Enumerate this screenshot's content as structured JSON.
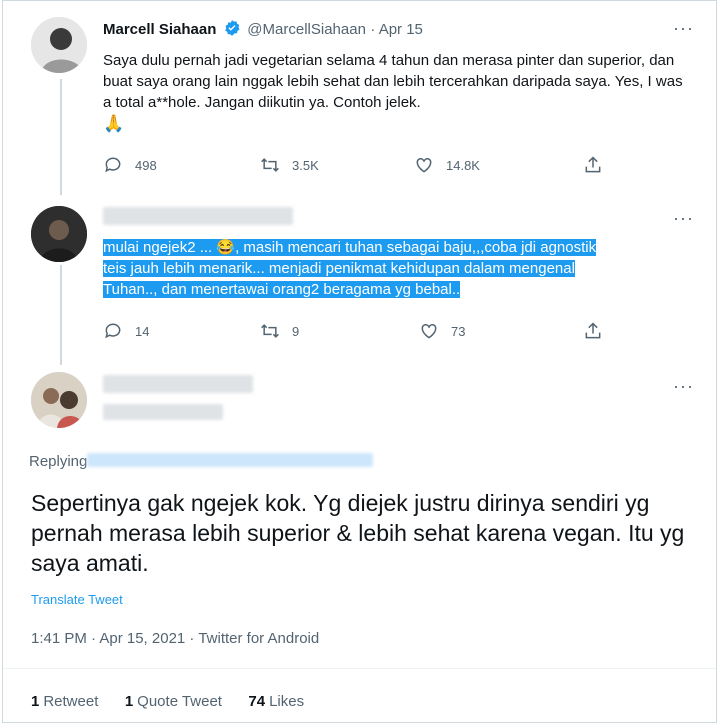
{
  "tweet1": {
    "name": "Marcell Siahaan",
    "handle": "@MarcellSiahaan",
    "date": "· Apr 15",
    "text": "Saya dulu pernah jadi vegetarian selama 4 tahun dan merasa pinter dan superior, dan buat saya orang lain nggak lebih sehat dan lebih tercerahkan daripada saya. Yes, I was a total a**hole. Jangan diikutin ya. Contoh jelek.",
    "emoji": "🙏",
    "replies": "498",
    "retweets": "3.5K",
    "likes": "14.8K"
  },
  "tweet2": {
    "line1": "mulai ngejek2 ... 😂, masih mencari tuhan sebagai baju,,,coba jdi agnostik",
    "line2": "teis jauh lebih menarik... menjadi  penikmat kehidupan dalam mengenal",
    "line3": "Tuhan.., dan menertawai  orang2 beragama yg bebal..",
    "replies": "14",
    "retweets": "9",
    "likes": "73"
  },
  "tweet3": {
    "replying_label": "Replying",
    "text": "Sepertinya gak ngejek kok. Yg diejek justru dirinya sendiri yg pernah merasa lebih superior & lebih sehat karena vegan. Itu yg saya amati.",
    "translate": "Translate Tweet",
    "meta": "1:41 PM · Apr 15, 2021 · Twitter for Android",
    "stats": {
      "retweets_count": "1",
      "retweets_label": "Retweet",
      "quotes_count": "1",
      "quotes_label": "Quote Tweet",
      "likes_count": "74",
      "likes_label": "Likes"
    }
  },
  "colors": {
    "accent": "#1d9bf0",
    "secondary_text": "#536471",
    "highlight": "#1d9bf0"
  }
}
